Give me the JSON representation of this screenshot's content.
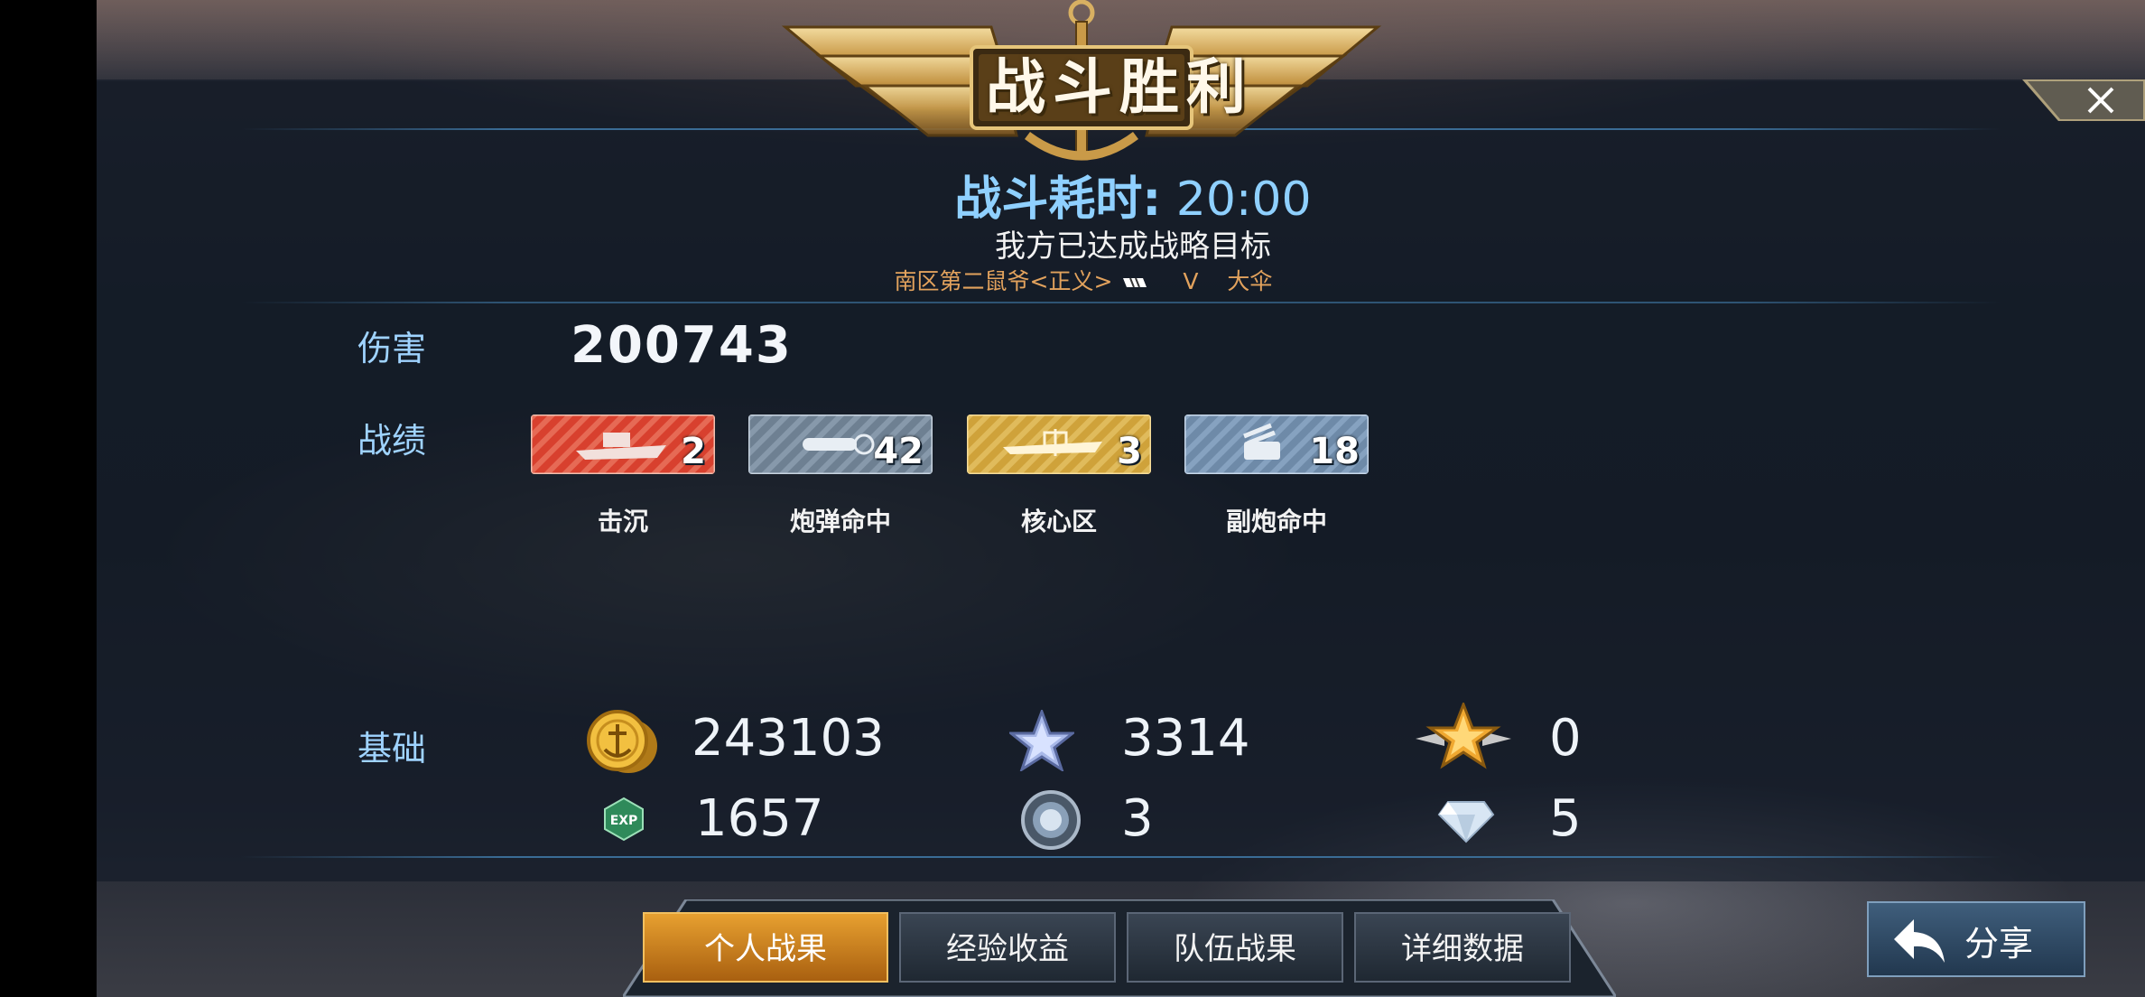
{
  "header": {
    "title": "战斗胜利",
    "duration_label": "战斗耗时:",
    "duration_value": "20:00",
    "subtitle": "我方已达成战略目标",
    "player_left": "南区第二鼠爷<正义>",
    "versus": "V",
    "player_right": "大伞"
  },
  "damage": {
    "label": "伤害",
    "value": "200743"
  },
  "record": {
    "label": "战绩",
    "medals": [
      {
        "name": "击沉",
        "count": "2",
        "icon": "ship-sink-icon",
        "color": "#d8402e"
      },
      {
        "name": "炮弹命中",
        "count": "42",
        "icon": "shell-hit-icon",
        "color": "#6e8092"
      },
      {
        "name": "核心区",
        "count": "3",
        "icon": "core-zone-icon",
        "color": "#cfa23a"
      },
      {
        "name": "副炮命中",
        "count": "18",
        "icon": "secondary-gun-icon",
        "color": "#6e8aa8"
      }
    ]
  },
  "base": {
    "label": "基础",
    "gold": "243103",
    "star_points": "3314",
    "gold_star": "0",
    "exp": "1657",
    "medal_coins": "3",
    "diamonds": "5",
    "exp_icon_text": "EXP"
  },
  "tabs": [
    {
      "label": "个人战果",
      "active": true
    },
    {
      "label": "经验收益",
      "active": false
    },
    {
      "label": "队伍战果",
      "active": false
    },
    {
      "label": "详细数据",
      "active": false
    }
  ],
  "share": {
    "label": "分享"
  },
  "colors": {
    "accent_blue": "#9fd3ff",
    "tab_active": "#e7a030",
    "player_orange": "#e2a25d"
  }
}
